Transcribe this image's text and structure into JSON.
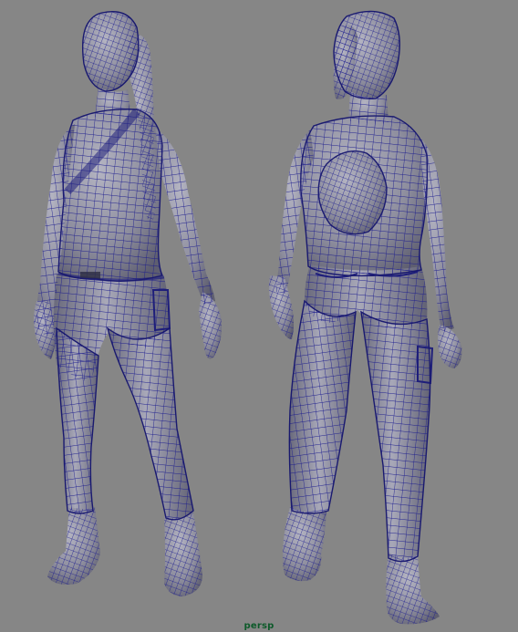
{
  "viewport": {
    "camera_label": "persp",
    "background_color": "#868686",
    "wireframe_color": "#1a1a8c",
    "shaded_color": "#8c8c9c"
  },
  "models": [
    {
      "name": "character-front-three-quarter-view"
    },
    {
      "name": "character-back-three-quarter-view"
    }
  ]
}
